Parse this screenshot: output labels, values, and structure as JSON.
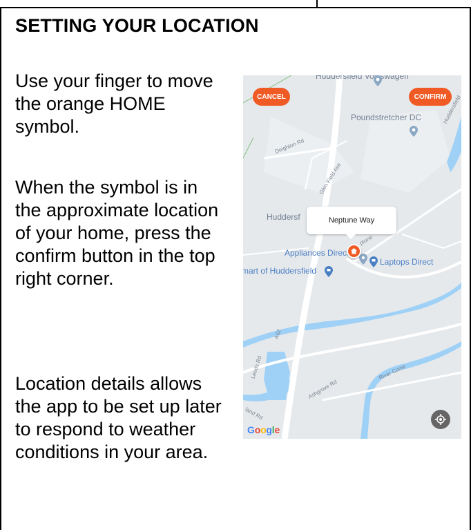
{
  "heading": "SETTING YOUR LOCATION",
  "paragraphs": [
    "Use your finger to move the orange HOME symbol.",
    "When the symbol is in the approximate location of your home, press the confirm button in the top right corner.",
    "Location details allows the app to be set up later to respond to weather conditions in your area."
  ],
  "map": {
    "cancel_label": "CANCEL",
    "confirm_label": "CONFIRM",
    "popup_label": "Neptune Way",
    "places": {
      "top_partial": "Huddersfield Volkswagen",
      "poundstretcher": "Poundstretcher DC",
      "huddersf": "Huddersf",
      "appliances": "Appliances Direct",
      "laptops": "Laptops Direct",
      "mart": "mart of Huddersfield"
    },
    "roads": {
      "deighton": "Deighton Rd",
      "glenfield": "Glen Field Ave",
      "neptune_partial": "ptune",
      "a62": "A62",
      "leeds": "Leeds Rd",
      "ashgrove": "Ashgrove Rd",
      "river": "River Colne",
      "land": "land Rd",
      "huddersfield_road": "Huddersfield"
    },
    "attribution": "Google",
    "colors": {
      "accent": "#f05a24",
      "water": "#9fd1f7",
      "background": "#e6e9ec"
    },
    "icons": {
      "home": "home-icon",
      "locate": "my-location-icon",
      "poi": "map-pin-icon"
    }
  }
}
